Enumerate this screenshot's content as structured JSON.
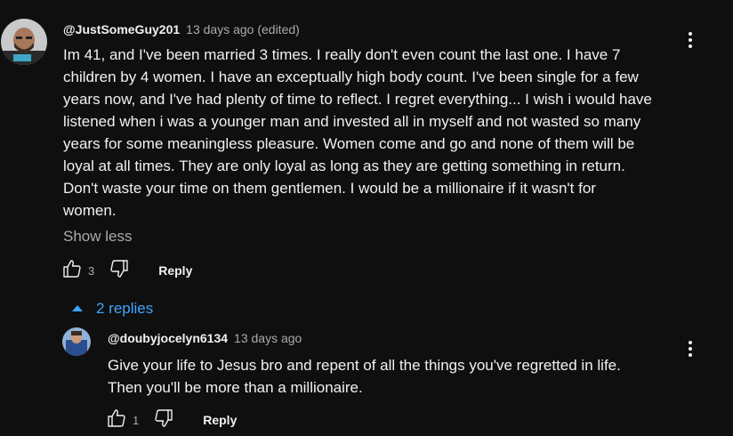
{
  "comment": {
    "author": "@JustSomeGuy201",
    "time": "13 days ago (edited)",
    "lines": [
      "Im 41, and I've been married 3 times. I really don't even count the last one. I have 7",
      "children by 4 women. I have an exceptually high body count. I've been single for a few",
      "years now, and I've had plenty of time to reflect. I regret everything... I wish i would have",
      "listened when i was a younger man and invested all in myself and not wasted so many",
      "years for some meaningless pleasure. Women come and go and none of them will be",
      "loyal at all times. They are only loyal as long as they are getting something in return.",
      "Don't waste your time on them gentlemen. I would be a millionaire if it wasn't for",
      "women."
    ],
    "show_less": "Show less",
    "like_count": "3",
    "reply_label": "Reply"
  },
  "replies_toggle": {
    "label": "2 replies"
  },
  "reply": {
    "author": "@doubyjocelyn6134",
    "time": "13 days ago",
    "lines": [
      "Give your life to Jesus bro and repent of all the things you've regretted in life.",
      "Then you'll be more than a millionaire."
    ],
    "like_count": "1",
    "reply_label": "Reply"
  },
  "colors": {
    "background": "#0f0f0f",
    "text": "#f1f1f1",
    "secondary": "#aaaaaa",
    "link": "#3ea6ff"
  },
  "icons": [
    "thumbs-up-icon",
    "thumbs-down-icon",
    "more-vertical-icon",
    "chevron-up-icon"
  ]
}
